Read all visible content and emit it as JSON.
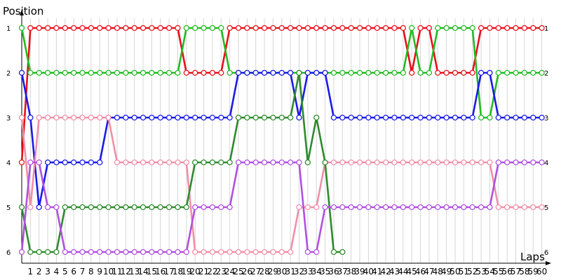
{
  "chart_data": {
    "type": "line",
    "title": "",
    "ylabel": "Position",
    "xlabel": "Laps",
    "x": [
      0,
      1,
      2,
      3,
      4,
      5,
      6,
      7,
      8,
      9,
      10,
      11,
      12,
      13,
      14,
      15,
      16,
      17,
      18,
      19,
      20,
      21,
      22,
      23,
      24,
      25,
      26,
      27,
      28,
      29,
      30,
      31,
      32,
      33,
      34,
      35,
      36,
      37,
      38,
      39,
      40,
      41,
      42,
      43,
      44,
      45,
      46,
      47,
      48,
      49,
      50,
      51,
      52,
      53,
      54,
      55,
      56,
      57,
      58,
      59,
      60
    ],
    "xlim": [
      0,
      60
    ],
    "ylim": [
      1,
      6
    ],
    "y_ticks": [
      "1",
      "2",
      "3",
      "4",
      "5",
      "6"
    ],
    "x_ticks": [
      "1",
      "2",
      "3",
      "4",
      "5",
      "6",
      "7",
      "8",
      "9",
      "10",
      "11",
      "12",
      "13",
      "14",
      "15",
      "16",
      "17",
      "18",
      "19",
      "20",
      "21",
      "22",
      "23",
      "24",
      "25",
      "26",
      "27",
      "28",
      "29",
      "30",
      "31",
      "32",
      "33",
      "34",
      "35",
      "36",
      "37",
      "38",
      "39",
      "40",
      "41",
      "42",
      "43",
      "44",
      "45",
      "46",
      "47",
      "48",
      "49",
      "50",
      "51",
      "52",
      "53",
      "54",
      "55",
      "56",
      "57",
      "58",
      "59",
      "60"
    ],
    "y_inverted": true,
    "grid": true,
    "series": [
      {
        "color": "#e8101a",
        "values": [
          4,
          1,
          1,
          1,
          1,
          1,
          1,
          1,
          1,
          1,
          1,
          1,
          1,
          1,
          1,
          1,
          1,
          1,
          1,
          2,
          2,
          2,
          2,
          2,
          1,
          1,
          1,
          1,
          1,
          1,
          1,
          1,
          1,
          1,
          1,
          1,
          1,
          1,
          1,
          1,
          1,
          1,
          1,
          1,
          1,
          2,
          1,
          1,
          2,
          2,
          2,
          2,
          2,
          1,
          1,
          1,
          1,
          1,
          1,
          1,
          1
        ]
      },
      {
        "color": "#22bb22",
        "values": [
          1,
          2,
          2,
          2,
          2,
          2,
          2,
          2,
          2,
          2,
          2,
          2,
          2,
          2,
          2,
          2,
          2,
          2,
          2,
          1,
          1,
          1,
          1,
          1,
          2,
          2,
          2,
          2,
          2,
          2,
          2,
          2,
          2,
          2,
          2,
          2,
          2,
          2,
          2,
          2,
          2,
          2,
          2,
          2,
          2,
          1,
          2,
          2,
          1,
          1,
          1,
          1,
          1,
          3,
          3,
          2,
          2,
          2,
          2,
          2,
          2
        ]
      },
      {
        "color": "#1a1ae8",
        "values": [
          2,
          3,
          5,
          4,
          4,
          4,
          4,
          4,
          4,
          4,
          3,
          3,
          3,
          3,
          3,
          3,
          3,
          3,
          3,
          3,
          3,
          3,
          3,
          3,
          3,
          2,
          2,
          2,
          2,
          2,
          2,
          2,
          3,
          2,
          2,
          2,
          3,
          3,
          3,
          3,
          3,
          3,
          3,
          3,
          3,
          3,
          3,
          3,
          3,
          3,
          3,
          3,
          3,
          2,
          2,
          3,
          3,
          3,
          3,
          3,
          3
        ]
      },
      {
        "color": "#f08fa8",
        "values": [
          3,
          5,
          3,
          3,
          3,
          3,
          3,
          3,
          3,
          3,
          3,
          4,
          4,
          4,
          4,
          4,
          4,
          4,
          4,
          4,
          6,
          6,
          6,
          6,
          6,
          6,
          6,
          6,
          6,
          6,
          6,
          6,
          5,
          5,
          5,
          4,
          4,
          4,
          4,
          4,
          4,
          4,
          4,
          4,
          4,
          4,
          4,
          4,
          4,
          4,
          4,
          4,
          4,
          4,
          4,
          5,
          5,
          5,
          5,
          5,
          5
        ]
      },
      {
        "color": "#2e8b2e",
        "values": [
          5,
          6,
          6,
          6,
          6,
          5,
          5,
          5,
          5,
          5,
          5,
          5,
          5,
          5,
          5,
          5,
          5,
          5,
          5,
          5,
          4,
          4,
          4,
          4,
          4,
          3,
          3,
          3,
          3,
          3,
          3,
          3,
          2,
          4,
          3,
          4,
          6,
          6,
          null,
          null,
          null,
          null,
          null,
          null,
          null,
          null,
          null,
          null,
          null,
          null,
          null,
          null,
          null,
          null,
          null,
          null,
          null,
          null,
          null,
          null,
          null
        ]
      },
      {
        "color": "#b050e0",
        "values": [
          6,
          4,
          4,
          5,
          5,
          6,
          6,
          6,
          6,
          6,
          6,
          6,
          6,
          6,
          6,
          6,
          6,
          6,
          6,
          6,
          5,
          5,
          5,
          5,
          5,
          4,
          4,
          4,
          4,
          4,
          4,
          4,
          4,
          6,
          6,
          5,
          5,
          5,
          5,
          5,
          5,
          5,
          5,
          5,
          5,
          5,
          5,
          5,
          5,
          5,
          5,
          5,
          5,
          5,
          5,
          4,
          4,
          4,
          4,
          4,
          4
        ]
      }
    ]
  }
}
